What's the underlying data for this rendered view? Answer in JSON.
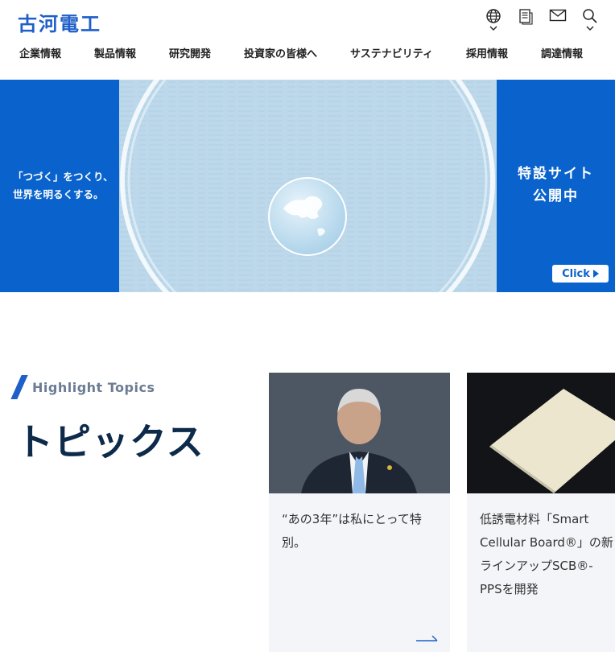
{
  "header": {
    "logo_text": "古河電工",
    "utils": [
      {
        "icon": "globe-icon"
      },
      {
        "icon": "document-icon"
      },
      {
        "icon": "mail-icon"
      },
      {
        "icon": "search-icon"
      }
    ]
  },
  "nav": {
    "items": [
      "企業情報",
      "製品情報",
      "研究開発",
      "投資家の皆様へ",
      "サステナビリティ",
      "採用情報",
      "調達情報"
    ]
  },
  "hero": {
    "left_line1": "「つづく」をつくり、",
    "left_line2": "世界を明るくする。",
    "right_line1": "特設サイト",
    "right_line2": "公開中",
    "click_label": "Click",
    "colors": {
      "blue": "#0a63cc",
      "sky": "#b9d7e8"
    }
  },
  "topics": {
    "eyebrow": "Highlight Topics",
    "title": "トピックス",
    "cards": [
      {
        "caption": "“あの3年”は私にとって特別。"
      },
      {
        "caption": "低誘電材料「Smart Cellular Board®」の新ラインアップSCB®-PPSを開発"
      }
    ]
  }
}
